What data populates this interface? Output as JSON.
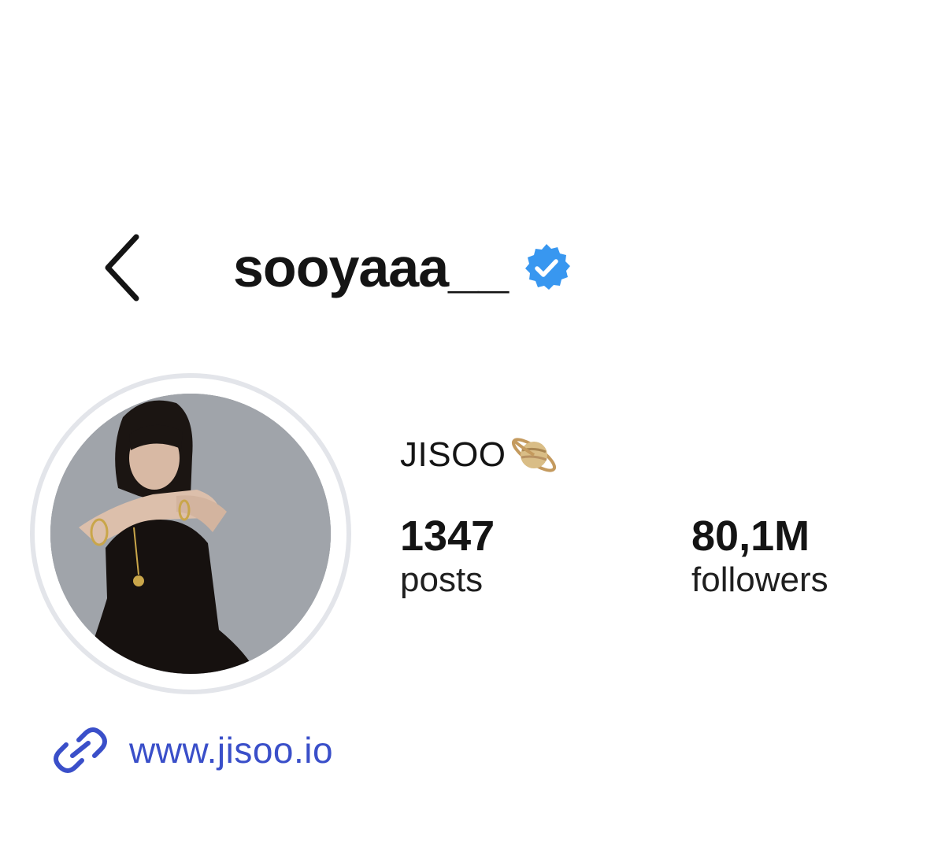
{
  "header": {
    "username": "sooyaaa__",
    "back_icon": "chevron-left-icon",
    "verified_icon": "verified-badge-icon"
  },
  "profile": {
    "avatar_icon": "profile-photo",
    "display_name": "JISOO",
    "display_name_emoji": "planet-icon"
  },
  "stats": {
    "posts": {
      "value": "1347",
      "label": "posts"
    },
    "followers": {
      "value": "80,1M",
      "label": "followers"
    }
  },
  "link": {
    "icon": "link-icon",
    "text": "www.jisoo.io"
  },
  "colors": {
    "verified_blue": "#3897f0",
    "link_blue": "#3a4fc9",
    "ring_gray": "#e3e5ea"
  }
}
